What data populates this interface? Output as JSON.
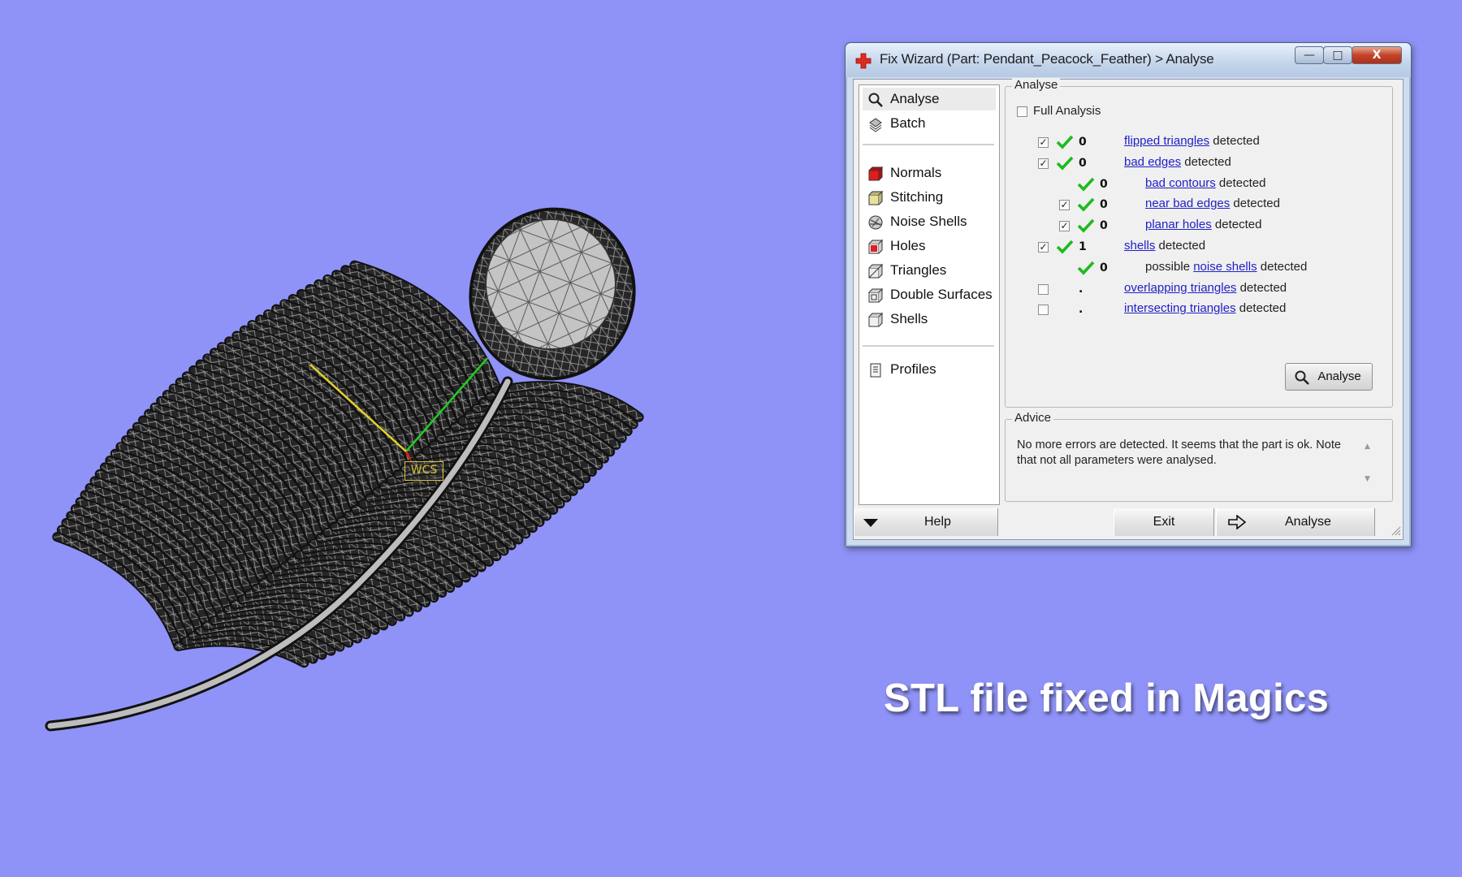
{
  "window": {
    "title": "Fix Wizard (Part: Pendant_Peacock_Feather) > Analyse",
    "controls": {
      "minimize": "—",
      "maximize": "□",
      "close": "X"
    }
  },
  "nav": {
    "items": [
      {
        "label": "Analyse",
        "icon": "magnifier-icon",
        "active": true
      },
      {
        "label": "Batch",
        "icon": "batch-icon"
      },
      {
        "label": "Normals",
        "icon": "normals-cube-icon"
      },
      {
        "label": "Stitching",
        "icon": "stitching-cube-icon"
      },
      {
        "label": "Noise Shells",
        "icon": "noise-shells-icon"
      },
      {
        "label": "Holes",
        "icon": "holes-cube-icon"
      },
      {
        "label": "Triangles",
        "icon": "triangles-cube-icon"
      },
      {
        "label": "Double Surfaces",
        "icon": "double-surfaces-icon"
      },
      {
        "label": "Shells",
        "icon": "shells-cube-icon"
      },
      {
        "label": "Profiles",
        "icon": "profiles-icon"
      }
    ]
  },
  "analyse": {
    "group_title": "Analyse",
    "full_analysis_label": "Full Analysis",
    "rows": [
      {
        "checked": true,
        "ok": true,
        "count": "0",
        "link": "flipped triangles",
        "suffix": " detected"
      },
      {
        "checked": true,
        "ok": true,
        "count": "0",
        "link": "bad edges",
        "suffix": " detected"
      },
      {
        "checkbox": false,
        "ok": true,
        "count": "0",
        "link": "bad contours",
        "suffix": " detected"
      },
      {
        "checked": true,
        "ok": true,
        "count": "0",
        "link": "near bad edges",
        "suffix": " detected"
      },
      {
        "checked": true,
        "ok": true,
        "count": "0",
        "link": "planar holes",
        "suffix": " detected"
      },
      {
        "checked": true,
        "ok": true,
        "count": "1",
        "link": "shells",
        "suffix": " detected"
      },
      {
        "checkbox": false,
        "ok": true,
        "count": "0",
        "prefix": "possible ",
        "link": "noise shells",
        "suffix": " detected"
      },
      {
        "checked": false,
        "ok": false,
        "count": ".",
        "link": "overlapping triangles",
        "suffix": " detected"
      },
      {
        "checked": false,
        "ok": false,
        "count": ".",
        "link": "intersecting triangles",
        "suffix": " detected"
      }
    ],
    "button_label": "Analyse"
  },
  "advice": {
    "group_title": "Advice",
    "text": "No more errors are detected. It seems that the part is ok. Note that not all parameters were analysed."
  },
  "bottom": {
    "help_label": "Help",
    "exit_label": "Exit",
    "analyse_label": "Analyse"
  },
  "viewport": {
    "wcs_label": "WCS"
  },
  "caption": "STL file fixed in Magics",
  "colors": {
    "background": "#8f93f7",
    "link": "#2020c8",
    "check_green": "#1dbb1d",
    "feather": "#1c1c1c"
  }
}
